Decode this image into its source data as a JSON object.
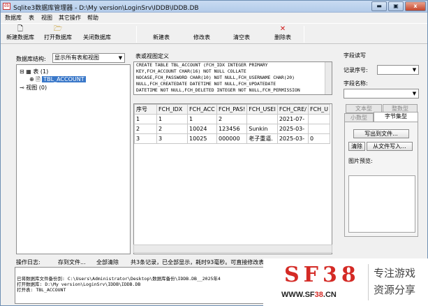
{
  "window": {
    "title": "Sqlite3数据库管理器 - D:\\My version\\LoginSrv\\IDDB\\IDDB.DB",
    "min": "▬",
    "max": "▣",
    "close": "x"
  },
  "menu": [
    "数据库",
    "表",
    "视图",
    "其它操作",
    "帮助"
  ],
  "toolbar": {
    "new_db": "新建数据库",
    "open_db": "打开数据库",
    "close_db": "关闭数据库",
    "new_table": "新建表",
    "edit_table": "修改表",
    "clear_table": "清空表",
    "delete_table": "删除表"
  },
  "left": {
    "structure_label": "数据库结构:",
    "filter_value": "显示所有表和视图",
    "tree": {
      "tables": "表 (1)",
      "table_item": "TBL_ACCOUNT",
      "views": "视图 (0)"
    }
  },
  "ddl": {
    "label": "表或视图定义",
    "lines": [
      "CREATE TABLE TBL_ACCOUNT (FCH_IDX INTEGER PRIMARY",
      "KEY,FCH_ACCOUNT CHAR(16) NOT NULL COLLATE",
      "NOCASE,FCH_PASSWORD CHAR(10) NOT NULL,FCH_USERNAME CHAR(20)",
      "NULL,FCH_CREATEDATE DATETIME NOT NULL,FCH_UPDATEDATE",
      "DATETIME NOT NULL,FCH_DELETED INTEGER NOT NULL,FCH_PERMISSION"
    ]
  },
  "grid": {
    "columns": [
      "序号",
      "FCH_IDX",
      "FCH_ACC",
      "FCH_PAS!",
      "FCH_USEI",
      "FCH_CRE/",
      "FCH_U"
    ],
    "rows": [
      [
        "1",
        "1",
        "1",
        "2",
        "",
        "2021-07-",
        ""
      ],
      [
        "2",
        "2",
        "10024",
        "123456",
        "Sunkin",
        "2025-03-",
        ""
      ],
      [
        "3",
        "3",
        "10025",
        "000000",
        "老子重逼.",
        "2025-03-",
        "0"
      ]
    ]
  },
  "field": {
    "title": "字段读写",
    "record_label": "记录序号:",
    "field_label": "字段名称:",
    "tabs": {
      "text": "文本型",
      "int": "整数型",
      "float": "小数型",
      "bytes": "字节集型"
    },
    "export_btn": "写出到文件...",
    "clear_btn": "清除",
    "import_btn": "从文件写入...",
    "preview_label": "图片预览:"
  },
  "status": {
    "log_label": "操作日志:",
    "save_btn": "存到文件...",
    "clear_btn": "全部清除",
    "info": "共3条记录，已全部显示，耗时93毫秒。可直接修改表内容"
  },
  "log": [
    "已将数据库文件备份到: C:\\Users\\Administrator\\Desktop\\数据库备份\\IDDB.DB__2025年4",
    "打开数据库: D:\\My version\\LoginSrv\\IDDB\\IDDB.DB",
    "打开表: TBL_ACCOUNT"
  ],
  "watermark": {
    "brand": "SF38",
    "url_a": "WWW.SF",
    "url_b": "38",
    "url_c": ".CN",
    "tag1": "专注游戏",
    "tag2": "资源分享",
    "brand_color": "#d42a25"
  }
}
